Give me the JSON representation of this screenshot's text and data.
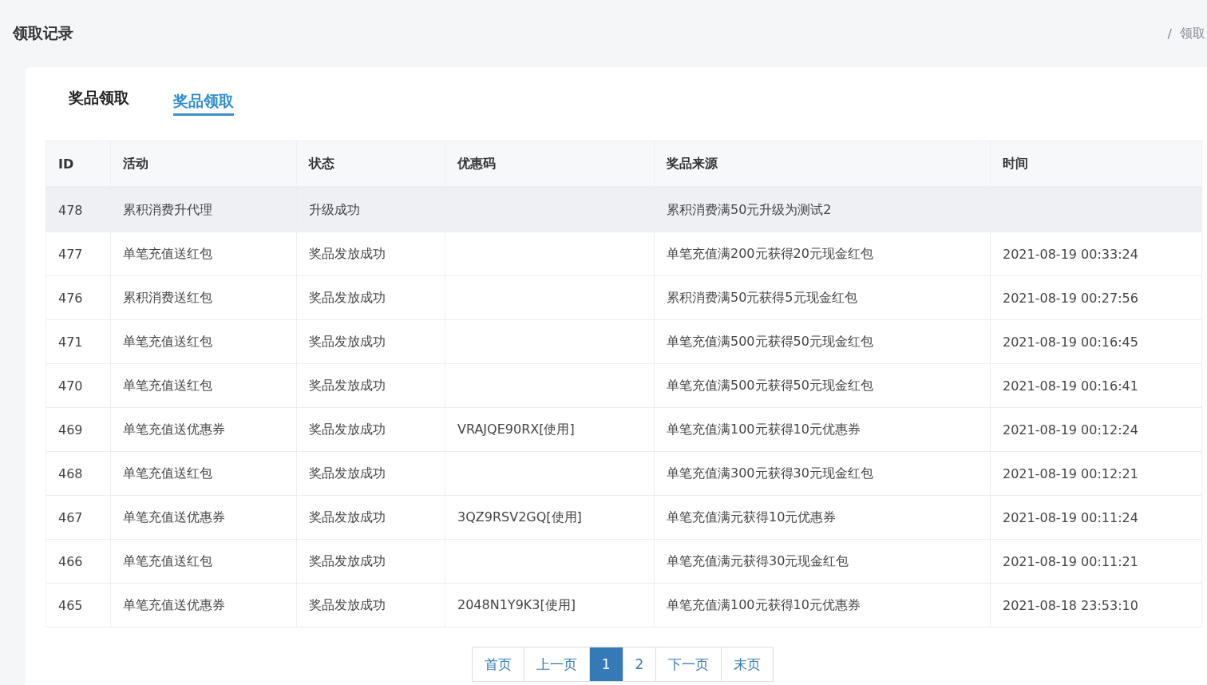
{
  "page_title": "领取记录",
  "breadcrumb": {
    "separator": "/",
    "current": "领取"
  },
  "tabs": [
    {
      "label": "奖品领取",
      "selected": false
    },
    {
      "label": "奖品领取",
      "selected": true
    }
  ],
  "table": {
    "columns": [
      "ID",
      "活动",
      "状态",
      "优惠码",
      "奖品来源",
      "时间"
    ],
    "rows": [
      {
        "selected": true,
        "cells": [
          "478",
          "累积消费升代理",
          "升级成功",
          "",
          "累积消费满50元升级为测试2",
          ""
        ]
      },
      {
        "selected": false,
        "cells": [
          "477",
          "单笔充值送红包",
          "奖品发放成功",
          "",
          "单笔充值满200元获得20元现金红包",
          "2021-08-19 00:33:24"
        ]
      },
      {
        "selected": false,
        "cells": [
          "476",
          "累积消费送红包",
          "奖品发放成功",
          "",
          "累积消费满50元获得5元现金红包",
          "2021-08-19 00:27:56"
        ]
      },
      {
        "selected": false,
        "cells": [
          "471",
          "单笔充值送红包",
          "奖品发放成功",
          "",
          "单笔充值满500元获得50元现金红包",
          "2021-08-19 00:16:45"
        ]
      },
      {
        "selected": false,
        "cells": [
          "470",
          "单笔充值送红包",
          "奖品发放成功",
          "",
          "单笔充值满500元获得50元现金红包",
          "2021-08-19 00:16:41"
        ]
      },
      {
        "selected": false,
        "cells": [
          "469",
          "单笔充值送优惠券",
          "奖品发放成功",
          "VRAJQE90RX[使用]",
          "单笔充值满100元获得10元优惠券",
          "2021-08-19 00:12:24"
        ]
      },
      {
        "selected": false,
        "cells": [
          "468",
          "单笔充值送红包",
          "奖品发放成功",
          "",
          "单笔充值满300元获得30元现金红包",
          "2021-08-19 00:12:21"
        ]
      },
      {
        "selected": false,
        "cells": [
          "467",
          "单笔充值送优惠券",
          "奖品发放成功",
          "3QZ9RSV2GQ[使用]",
          "单笔充值满元获得10元优惠券",
          "2021-08-19 00:11:24"
        ]
      },
      {
        "selected": false,
        "cells": [
          "466",
          "单笔充值送红包",
          "奖品发放成功",
          "",
          "单笔充值满元获得30元现金红包",
          "2021-08-19 00:11:21"
        ]
      },
      {
        "selected": false,
        "cells": [
          "465",
          "单笔充值送优惠券",
          "奖品发放成功",
          "2048N1Y9K3[使用]",
          "单笔充值满100元获得10元优惠券",
          "2021-08-18 23:53:10"
        ]
      }
    ]
  },
  "pagination": {
    "first": "首页",
    "prev": "上一页",
    "pages": [
      {
        "label": "1",
        "selected": true
      },
      {
        "label": "2",
        "selected": false
      }
    ],
    "next": "下一页",
    "last": "末页"
  }
}
